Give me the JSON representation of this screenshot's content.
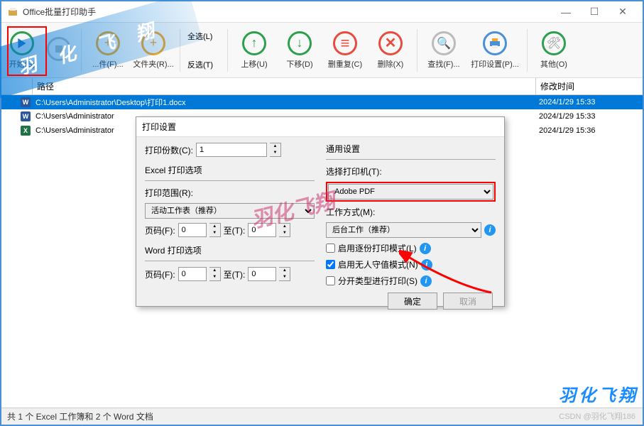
{
  "window": {
    "title": "Office批量打印助手"
  },
  "toolbar": {
    "start": "开始(S)",
    "stop": "",
    "file": "...件(F)...",
    "folder": "文件夹(R)...",
    "selectAll": "全选(L)",
    "invert": "反选(T)",
    "moveUp": "上移(U)",
    "moveDown": "下移(D)",
    "removeDup": "删重复(C)",
    "delete": "删除(X)",
    "find": "查找(F)...",
    "printSetup": "打印设置(P)...",
    "other": "其他(O)"
  },
  "ribbon": "羽 化 飞 翔",
  "list": {
    "hdr_path": "路径",
    "hdr_time": "修改时间",
    "rows": [
      {
        "icon": "W",
        "color": "#2b579a",
        "path": "C:\\Users\\Administrator\\Desktop\\打印1.docx",
        "time": "2024/1/29 15:33",
        "sel": true
      },
      {
        "icon": "W",
        "color": "#2b579a",
        "path": "C:\\Users\\Administrator",
        "time": "2024/1/29 15:33",
        "sel": false
      },
      {
        "icon": "X",
        "color": "#217346",
        "path": "C:\\Users\\Administrator",
        "time": "2024/1/29 15:36",
        "sel": false
      }
    ]
  },
  "dialog": {
    "title": "打印设置",
    "copies_label": "打印份数(C):",
    "copies_value": "1",
    "excel_group": "Excel 打印选项",
    "range_label": "打印范围(R):",
    "range_value": "活动工作表（推荐）",
    "page_label": "页码(F):",
    "page_from": "0",
    "to_label": "至(T):",
    "page_to": "0",
    "word_group": "Word 打印选项",
    "common_group": "通用设置",
    "printer_label": "选择打印机(T):",
    "printer_value": "Adobe PDF",
    "mode_label": "工作方式(M):",
    "mode_value": "后台工作（推荐）",
    "chk1": "启用逐份打印模式(L)",
    "chk2": "启用无人守值模式(N)",
    "chk3": "分开类型进行打印(S)",
    "ok": "确定",
    "cancel": "取消"
  },
  "watermark2": "羽化飞翔",
  "status": "共 1 个 Excel 工作簿和 2 个 Word 文档",
  "sig": "羽化飞翔",
  "csdn": "CSDN @羽化飞翔186"
}
